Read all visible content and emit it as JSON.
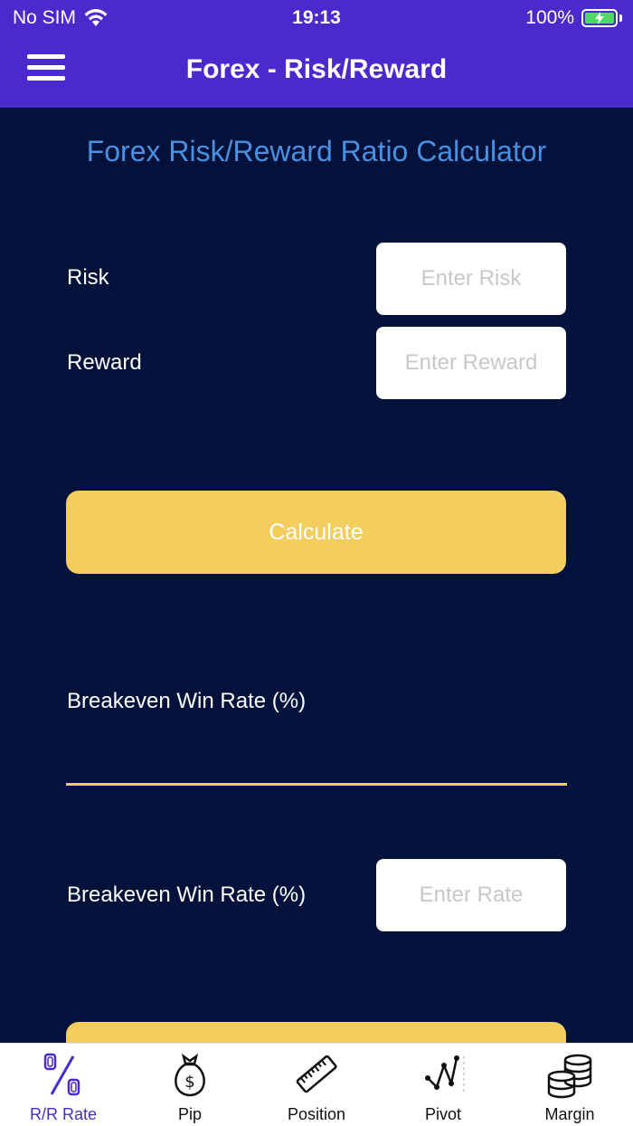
{
  "status": {
    "carrier": "No SIM",
    "time": "19:13",
    "battery": "100%"
  },
  "nav": {
    "title": "Forex - Risk/Reward"
  },
  "main": {
    "heading": "Forex Risk/Reward Ratio Calculator",
    "risk": {
      "label": "Risk",
      "placeholder": "Enter Risk",
      "value": ""
    },
    "reward": {
      "label": "Reward",
      "placeholder": "Enter Reward",
      "value": ""
    },
    "calculate_label": "Calculate",
    "result": {
      "label": "Breakeven Win Rate (%)",
      "value": ""
    },
    "rate": {
      "label": "Breakeven Win Rate (%)",
      "placeholder": "Enter Rate",
      "value": ""
    }
  },
  "tabs": [
    {
      "label": "R/R Rate",
      "icon": "percent-icon",
      "active": true
    },
    {
      "label": "Pip",
      "icon": "money-bag-icon",
      "active": false
    },
    {
      "label": "Position",
      "icon": "ruler-icon",
      "active": false
    },
    {
      "label": "Pivot",
      "icon": "pivot-chart-icon",
      "active": false
    },
    {
      "label": "Margin",
      "icon": "coins-icon",
      "active": false
    }
  ],
  "colors": {
    "header": "#4a2acc",
    "background": "#03123a",
    "heading": "#4a90e2",
    "accent": "#f3cd5e",
    "active_tab": "#4a2acc"
  }
}
